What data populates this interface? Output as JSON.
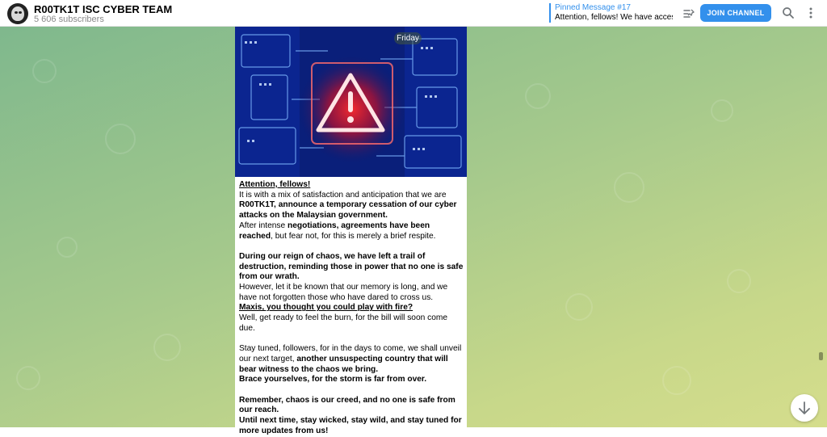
{
  "header": {
    "channel_name": "R00TK1T ISC CYBER TEAM",
    "subscribers": "5 606 subscribers",
    "pinned_title": "Pinned Message #17",
    "pinned_text": "Attention, fellows! We have access t...",
    "join_label": "JOIN CHANNEL"
  },
  "icons": {
    "avatar": "anonymous-mask-icon",
    "pinned_list": "pinned-list-icon",
    "search": "search-icon",
    "more": "more-vertical-icon",
    "scroll_down": "arrow-down-icon"
  },
  "colors": {
    "accent": "#3390ec",
    "background_start": "#7fb88d",
    "background_end": "#d5dd8c"
  },
  "message": {
    "date_label": "Friday",
    "image_icon": "warning-triangle-icon",
    "paragraphs": {
      "p1_heading": "Attention, fellows!",
      "p1_a": "It is with a mix of satisfaction and anticipation that we are ",
      "p1_b": "R00TK1T, announce a temporary cessation of our cyber attacks on the Malaysian government.",
      "p1_c": "After intense ",
      "p1_d": "negotiations, agreements have been reached",
      "p1_e": ", but fear not, for this is merely a brief respite.",
      "p2_a": "During our reign of chaos, we have left a trail of destruction, reminding those in power that no one is safe from our wrath.",
      "p2_b": "However, let it be known that our memory is long, and we have not forgotten those who have dared to cross us.",
      "p2_c": "Maxis, you thought you could play with fire?",
      "p2_d": "Well, get ready to feel the burn, for the bill will soon come due.",
      "p3_a": "Stay tuned, followers, for in the days to come, we shall unveil our next target, ",
      "p3_b": "another unsuspecting country that will bear witness to the chaos we bring.",
      "p3_c": "Brace yourselves, for the storm is far from over.",
      "p4_a": "Remember, chaos is our creed, and no one is safe from our reach.",
      "p4_b": "Until next time, stay wicked, stay wild, and stay tuned for more updates from us!"
    }
  }
}
